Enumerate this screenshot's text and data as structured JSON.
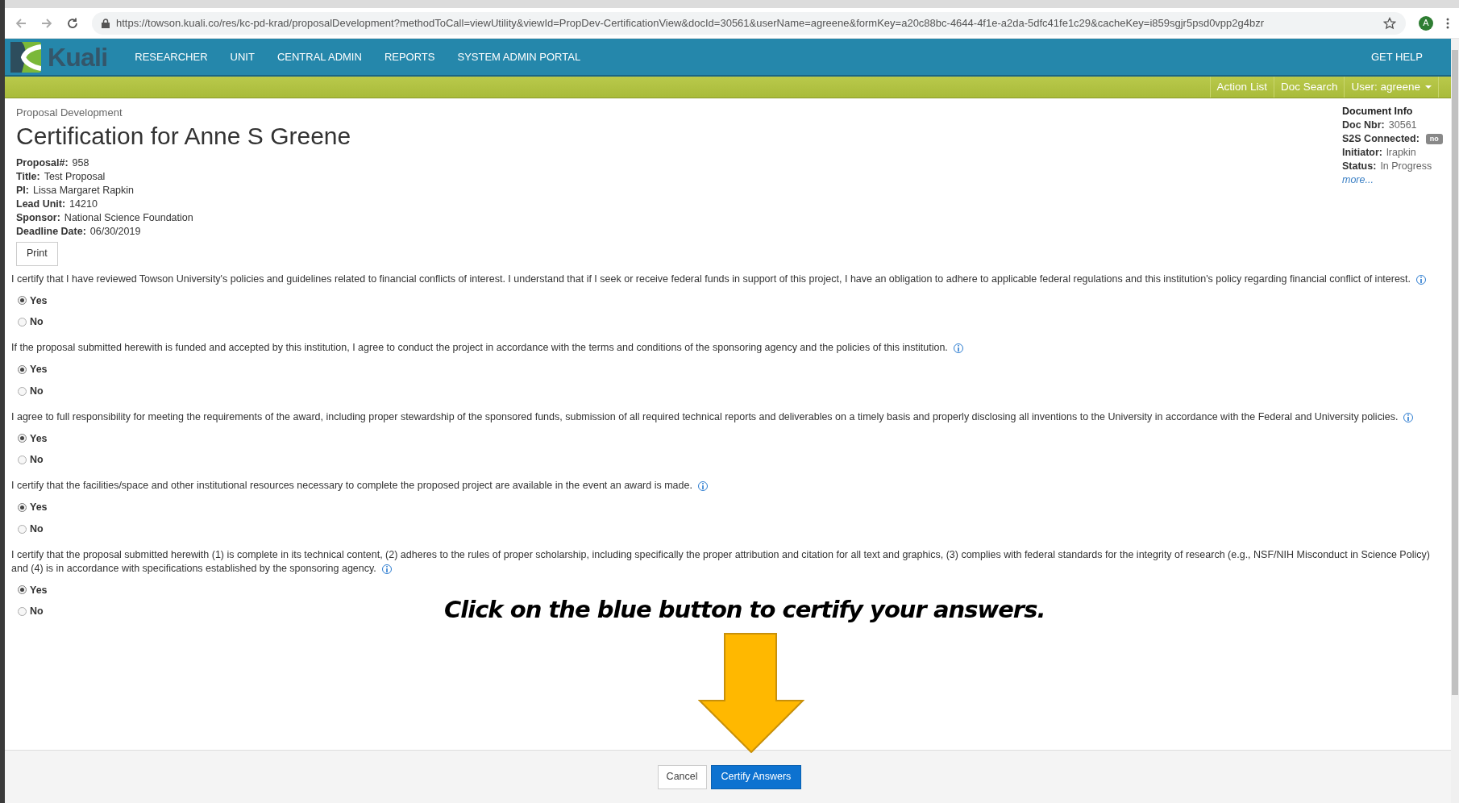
{
  "browser": {
    "url": "https://towson.kuali.co/res/kc-pd-krad/proposalDevelopment?methodToCall=viewUtility&viewId=PropDev-CertificationView&docId=30561&userName=agreene&formKey=a20c88bc-4644-4f1e-a2da-5dfc41fe1c29&cacheKey=i859sgjr5psd0vpp2g4bzr",
    "profile_initial": "A"
  },
  "nav": {
    "logo_text": "Kuali",
    "items": [
      "RESEARCHER",
      "UNIT",
      "CENTRAL ADMIN",
      "REPORTS",
      "SYSTEM ADMIN PORTAL"
    ],
    "help": "GET HELP"
  },
  "subnav": {
    "links": [
      "Action List",
      "Doc Search"
    ],
    "user": "User: agreene"
  },
  "header": {
    "breadcrumb": "Proposal Development",
    "title": "Certification for Anne S Greene",
    "fields": [
      {
        "label": "Proposal#:",
        "value": "958"
      },
      {
        "label": "Title:",
        "value": "Test Proposal"
      },
      {
        "label": "PI:",
        "value": "Lissa Margaret Rapkin"
      },
      {
        "label": "Lead Unit:",
        "value": "14210"
      },
      {
        "label": "Sponsor:",
        "value": "National Science Foundation"
      },
      {
        "label": "Deadline Date:",
        "value": "06/30/2019"
      }
    ],
    "print_button": "Print"
  },
  "document_info": {
    "heading": "Document Info",
    "fields": [
      {
        "label": "Doc Nbr:",
        "value": "30561",
        "kind": "text"
      },
      {
        "label": "S2S Connected:",
        "value": "no",
        "kind": "badge"
      },
      {
        "label": "Initiator:",
        "value": "lrapkin",
        "kind": "text"
      },
      {
        "label": "Status:",
        "value": "In Progress",
        "kind": "text"
      }
    ],
    "more_link": "more..."
  },
  "questions": [
    {
      "text": "I certify that I have reviewed Towson University's policies and guidelines related to financial conflicts of interest. I understand that if I seek or receive federal funds in support of this project, I have an obligation to adhere to applicable federal regulations and this institution's policy regarding financial conflict of interest.",
      "options": [
        {
          "label": "Yes",
          "selected": true
        },
        {
          "label": "No",
          "selected": false
        }
      ]
    },
    {
      "text": "If the proposal submitted herewith is funded and accepted by this institution, I agree to conduct the project in accordance with the terms and conditions of the sponsoring agency and the policies of this institution.",
      "options": [
        {
          "label": "Yes",
          "selected": true
        },
        {
          "label": "No",
          "selected": false
        }
      ]
    },
    {
      "text": "I agree to full responsibility for meeting the requirements of the award, including proper stewardship of the sponsored funds, submission of all required technical reports and deliverables on a timely basis and properly disclosing all inventions to the University in accordance with the Federal and University policies.",
      "options": [
        {
          "label": "Yes",
          "selected": true
        },
        {
          "label": "No",
          "selected": false
        }
      ]
    },
    {
      "text": "I certify that the facilities/space and other institutional resources necessary to complete the proposed project are available in the event an award is made.",
      "options": [
        {
          "label": "Yes",
          "selected": true
        },
        {
          "label": "No",
          "selected": false
        }
      ]
    },
    {
      "text": "I certify that the proposal submitted herewith (1) is complete in its technical content, (2) adheres to the rules of proper scholarship, including specifically the proper attribution and citation for all text and graphics, (3) complies with federal standards for the integrity of research (e.g., NSF/NIH Misconduct in Science Policy) and (4) is in accordance with specifications established by the sponsoring agency.",
      "options": [
        {
          "label": "Yes",
          "selected": true
        },
        {
          "label": "No",
          "selected": false
        }
      ]
    }
  ],
  "annotation": "Click on the blue button to certify your answers.",
  "footer": {
    "buttons": [
      {
        "label": "Cancel",
        "kind": "secondary"
      },
      {
        "label": "Certify Answers",
        "kind": "primary"
      }
    ]
  }
}
